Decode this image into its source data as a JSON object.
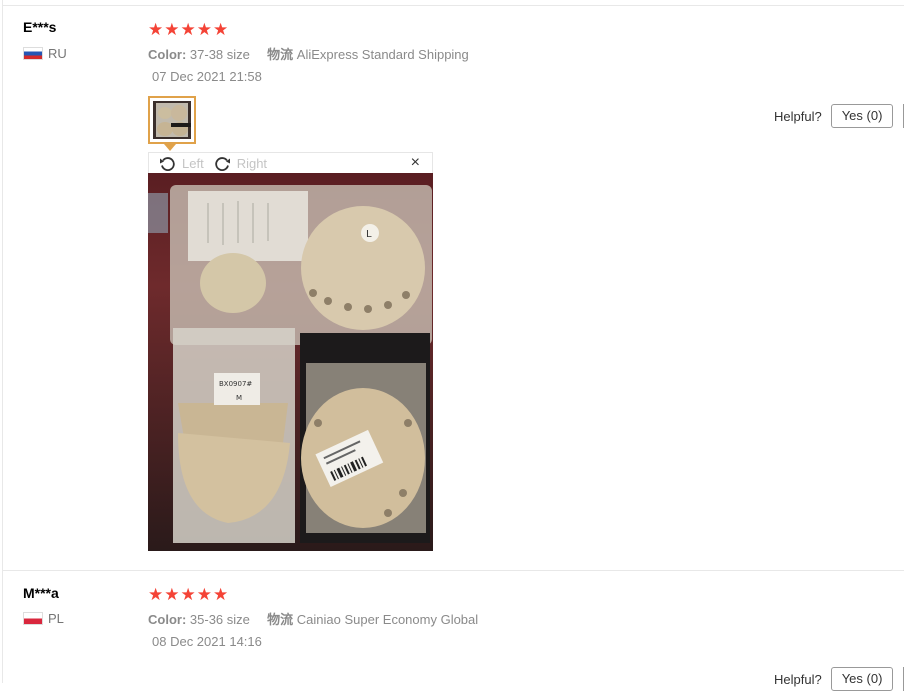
{
  "reviews": [
    {
      "user": "E***s",
      "country": "RU",
      "rating": 5,
      "color_key": "Color:",
      "color_value": "37-38 size",
      "shipping_key": "物流",
      "shipping_value": "AliExpress Standard Shipping",
      "date": "07 Dec 2021 21:58",
      "helpful_label": "Helpful?",
      "yes_label": "Yes (0)"
    },
    {
      "user": "M***a",
      "country": "PL",
      "rating": 5,
      "color_key": "Color:",
      "color_value": "35-36 size",
      "shipping_key": "物流",
      "shipping_value": "Cainiao Super Economy Global",
      "date": "08 Dec 2021 14:16",
      "helpful_label": "Helpful?",
      "yes_label": "Yes (0)"
    }
  ],
  "viewer": {
    "rotate_left": "Left",
    "rotate_right": "Right",
    "close": "×",
    "photo_labels": {
      "badge": "L",
      "tag": "BX0907#",
      "tag_size": "M"
    }
  },
  "colors": {
    "star": "#f44336",
    "thumb_border": "#e0a24a",
    "meta_text": "#8a8a8a"
  },
  "icons": {
    "star": "★",
    "rotate_left": "rotate-left-icon",
    "rotate_right": "rotate-right-icon",
    "close": "close-icon",
    "flag_ru": "flag-ru-icon",
    "flag_pl": "flag-pl-icon"
  }
}
